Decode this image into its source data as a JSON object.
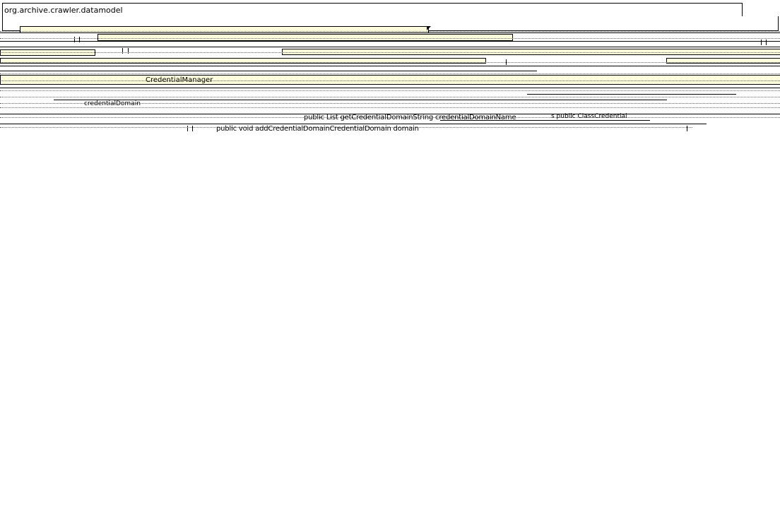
{
  "package": {
    "name": "org.archive.crawler.datamodel"
  },
  "diagram": {
    "class_name": "CredentialManager",
    "methods": [
      "public List getCredentialDomainString credentialDomainName",
      "public void addCredentialDomainCredentialDomain domain"
    ],
    "misc_labels": [
      "credentialDomain",
      "s public ClassCredential"
    ]
  }
}
